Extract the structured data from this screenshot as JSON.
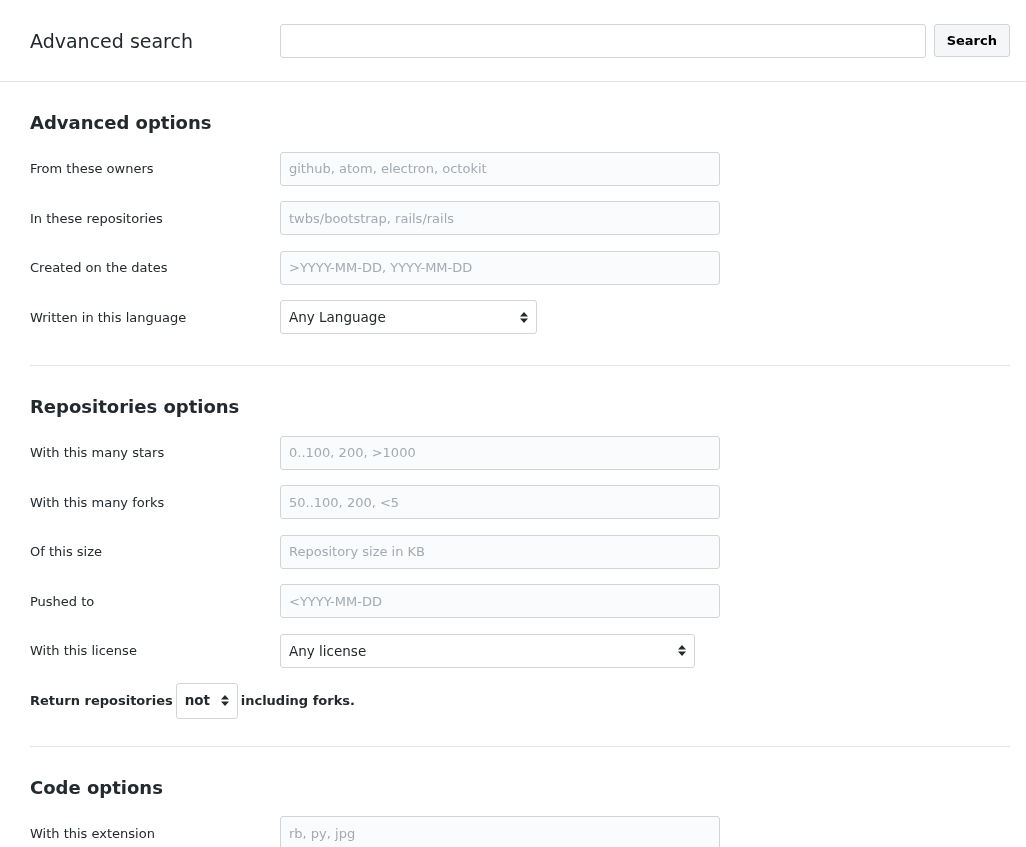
{
  "header": {
    "title": "Advanced search",
    "search_button": "Search"
  },
  "sections": [
    {
      "title": "Advanced options",
      "rows": [
        {
          "kind": "input",
          "label": "From these owners",
          "placeholder": "github, atom, electron, octokit"
        },
        {
          "kind": "input",
          "label": "In these repositories",
          "placeholder": "twbs/bootstrap, rails/rails"
        },
        {
          "kind": "input",
          "label": "Created on the dates",
          "placeholder": ">YYYY-MM-DD, YYYY-MM-DD"
        },
        {
          "kind": "select",
          "label": "Written in this language",
          "value": "Any Language"
        }
      ]
    },
    {
      "title": "Repositories options",
      "rows": [
        {
          "kind": "input",
          "label": "With this many stars",
          "placeholder": "0..100, 200, >1000"
        },
        {
          "kind": "input",
          "label": "With this many forks",
          "placeholder": "50..100, 200, <5"
        },
        {
          "kind": "input",
          "label": "Of this size",
          "placeholder": "Repository size in KB"
        },
        {
          "kind": "input",
          "label": "Pushed to",
          "placeholder": "<YYYY-MM-DD"
        },
        {
          "kind": "select",
          "label": "With this license",
          "value": "Any license"
        },
        {
          "kind": "sentence",
          "before": "Return repositories",
          "value": "not",
          "after": "including forks."
        }
      ]
    },
    {
      "title": "Code options",
      "rows": [
        {
          "kind": "input",
          "label": "With this extension",
          "placeholder": "rb, py, jpg"
        }
      ]
    }
  ]
}
